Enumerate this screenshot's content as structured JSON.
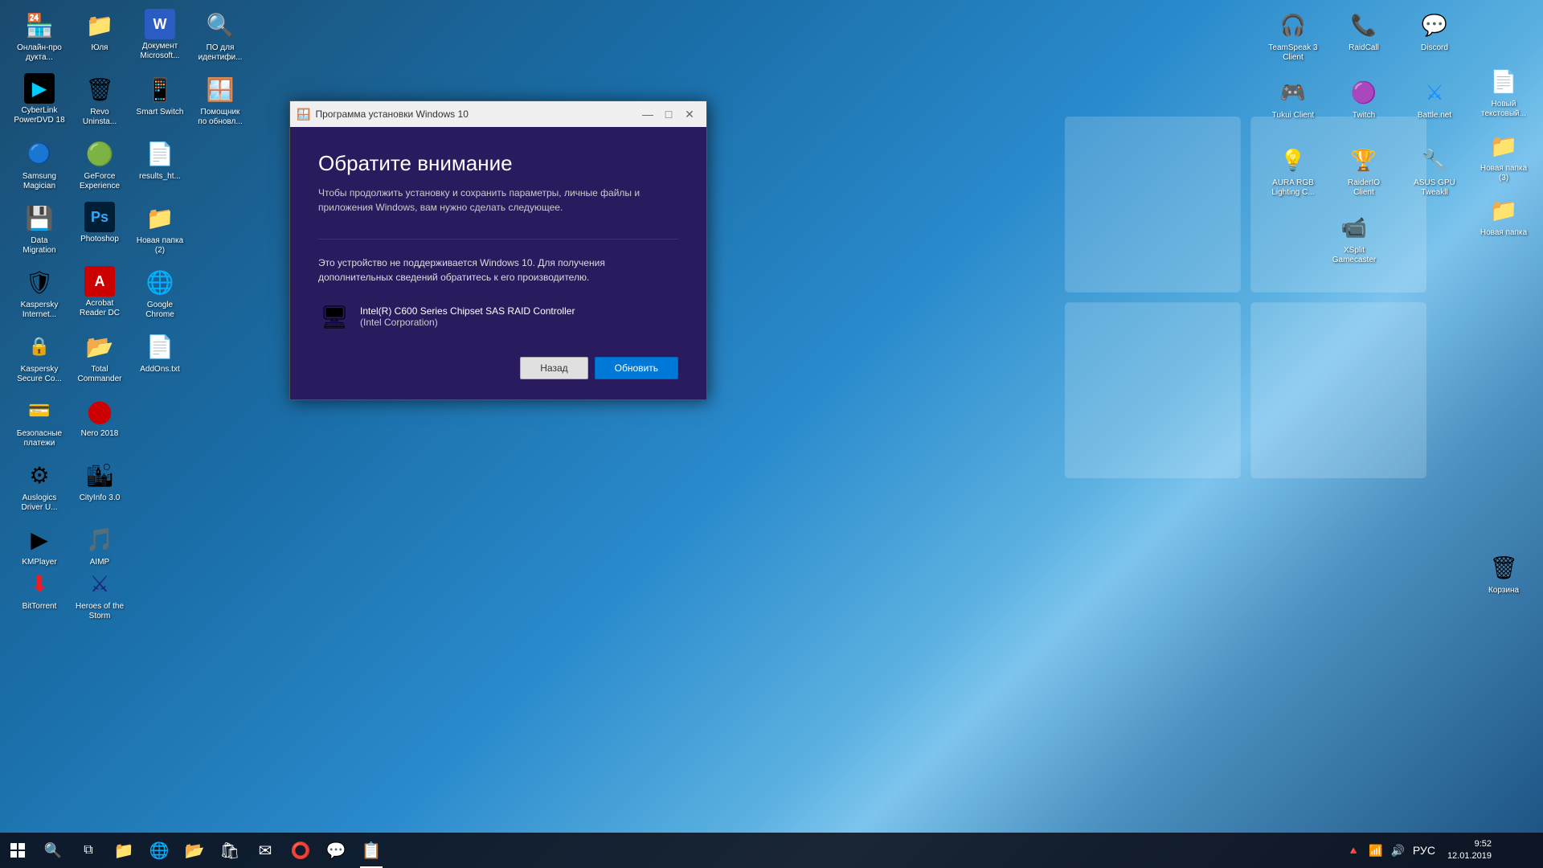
{
  "desktop": {
    "background": "Windows 10 blue gradient desktop"
  },
  "icons_left": [
    {
      "id": "online-product",
      "label": "Онлайн-про\nдукта...",
      "emoji": "🏪",
      "color": "#00aaff"
    },
    {
      "id": "yulia",
      "label": "Юля",
      "emoji": "📁",
      "color": "#ffcc00"
    },
    {
      "id": "word-doc",
      "label": "Документ Microsoft...",
      "emoji": "📄",
      "color": "#2b5cc4"
    },
    {
      "id": "po-dlia-ident",
      "label": "ПО для идентифи...",
      "emoji": "🔍",
      "color": "#aaaaaa"
    },
    {
      "id": "pomoshnik",
      "label": "Помощник по обновл...",
      "emoji": "🪟",
      "color": "#0078d7"
    },
    {
      "id": "cyberlink",
      "label": "CyberLink PowerDVD 18",
      "emoji": "▶",
      "color": "#1a3a6e"
    },
    {
      "id": "revo",
      "label": "Revo Uninsta...",
      "emoji": "🗑",
      "color": "#ff4400"
    },
    {
      "id": "smart-switch",
      "label": "Smart Switch",
      "emoji": "📱",
      "color": "#1565c0"
    },
    {
      "id": "samsung-magician",
      "label": "Samsung Magician",
      "emoji": "💿",
      "color": "#1e88e5"
    },
    {
      "id": "geforce",
      "label": "GeForce Experience",
      "emoji": "🟢",
      "color": "#76b900"
    },
    {
      "id": "results",
      "label": "results_ht...",
      "emoji": "📄",
      "color": "#cc0000"
    },
    {
      "id": "data-migration",
      "label": "Data Migration",
      "emoji": "💾",
      "color": "#1565c0"
    },
    {
      "id": "photoshop",
      "label": "Photoshop",
      "emoji": "🅿",
      "color": "#001e36"
    },
    {
      "id": "new-folder-2",
      "label": "Новая папка (2)",
      "emoji": "📁",
      "color": "#ffcc00"
    },
    {
      "id": "kaspersky-internet",
      "label": "Kaspersky Internet...",
      "emoji": "🛡",
      "color": "#009900"
    },
    {
      "id": "acrobat",
      "label": "Acrobat Reader DC",
      "emoji": "📕",
      "color": "#cc0000"
    },
    {
      "id": "google-chrome",
      "label": "Google Chrome",
      "emoji": "🌐",
      "color": "#4285f4"
    },
    {
      "id": "kaspersky-secure",
      "label": "Kaspersky Secure Co...",
      "emoji": "🔒",
      "color": "#009900"
    },
    {
      "id": "total-commander",
      "label": "Total Commander",
      "emoji": "📂",
      "color": "#ffcc00"
    },
    {
      "id": "addons",
      "label": "AddOns.txt",
      "emoji": "📄",
      "color": "#cccccc"
    },
    {
      "id": "bezopasnye",
      "label": "Безопасные платежи",
      "emoji": "💳",
      "color": "#009900"
    },
    {
      "id": "nero",
      "label": "Nero 2018",
      "emoji": "🔴",
      "color": "#cc0000"
    },
    {
      "id": "auslogics",
      "label": "Auslogics Driver U...",
      "emoji": "⚙",
      "color": "#0066cc"
    },
    {
      "id": "cityinfo",
      "label": "CityInfo 3.0",
      "emoji": "🏙",
      "color": "#0066ff"
    },
    {
      "id": "kmplayer",
      "label": "KMPlayer",
      "emoji": "▶",
      "color": "#ffcc00"
    },
    {
      "id": "aimp",
      "label": "AIMP",
      "emoji": "🎵",
      "color": "#ff6600"
    },
    {
      "id": "bittorrent",
      "label": "BitTorrent",
      "emoji": "⬇",
      "color": "#ee1c24"
    },
    {
      "id": "heroes-storm",
      "label": "Heroes of the Storm",
      "emoji": "⚔",
      "color": "#1a237e"
    }
  ],
  "icons_right": [
    {
      "id": "teamspeak",
      "label": "TeamSpeak 3 Client",
      "emoji": "🎧",
      "color": "#1a6ea8"
    },
    {
      "id": "raidcall",
      "label": "RaidCall",
      "emoji": "📞",
      "color": "#336699"
    },
    {
      "id": "discord",
      "label": "Discord",
      "emoji": "💬",
      "color": "#7289da"
    },
    {
      "id": "tukui",
      "label": "Tukui Client",
      "emoji": "🎮",
      "color": "#cc6600"
    },
    {
      "id": "twitch",
      "label": "Twitch",
      "emoji": "🟣",
      "color": "#6441a5"
    },
    {
      "id": "battlenet",
      "label": "Battle.net",
      "emoji": "⚔",
      "color": "#148eff"
    },
    {
      "id": "aura-rgb",
      "label": "AURA RGB Lighting C...",
      "emoji": "💡",
      "color": "#333"
    },
    {
      "id": "raiderio",
      "label": "RaiderIO Client",
      "emoji": "🏆",
      "color": "#cc3300"
    },
    {
      "id": "asus-gpu",
      "label": "ASUS GPU Tweakll",
      "emoji": "🔧",
      "color": "#0066cc"
    },
    {
      "id": "xsplit",
      "label": "XSplit Gamecaster",
      "emoji": "📹",
      "color": "#1565c0"
    },
    {
      "id": "new-folder-3",
      "label": "Новая папка (3)",
      "emoji": "📁",
      "color": "#ffcc00"
    },
    {
      "id": "new-folder",
      "label": "Новая папка",
      "emoji": "📁",
      "color": "#ffcc00"
    },
    {
      "id": "recycle",
      "label": "Корзина",
      "emoji": "🗑",
      "color": "#aaaaaa"
    },
    {
      "id": "new-txt",
      "label": "Новый текстовый...",
      "emoji": "📄",
      "color": "#cccccc"
    }
  ],
  "taskbar": {
    "start_icon": "⊞",
    "search_icon": "🔍",
    "task_view_icon": "⧉",
    "apps": [
      {
        "id": "explorer-icon",
        "emoji": "📁",
        "active": false
      },
      {
        "id": "edge-icon",
        "emoji": "🌐",
        "active": false
      },
      {
        "id": "files-icon",
        "emoji": "📂",
        "active": false
      },
      {
        "id": "store-icon",
        "emoji": "🛍",
        "active": false
      },
      {
        "id": "mail-icon",
        "emoji": "✉",
        "active": false
      },
      {
        "id": "opera-icon",
        "emoji": "⭕",
        "active": false
      },
      {
        "id": "discord-task",
        "emoji": "💬",
        "active": false
      },
      {
        "id": "active-app",
        "emoji": "📋",
        "active": true
      }
    ],
    "sys_icons": [
      "🔺",
      "🔊",
      "📶",
      "RU"
    ],
    "time": "9:52",
    "date": "12.01.2019",
    "lang": "РУС"
  },
  "dialog": {
    "title": "Программа установки Windows 10",
    "title_icon": "🪟",
    "heading": "Обратите внимание",
    "subtitle": "Чтобы продолжить установку и сохранить параметры, личные файлы и приложения Windows, вам нужно сделать следующее.",
    "warning": "Это устройство не поддерживается Windows 10. Для получения дополнительных сведений обратитесь к его производителю.",
    "device_name": "Intel(R) C600 Series Chipset SAS RAID Controller",
    "device_vendor": "(Intel Corporation)",
    "btn_back": "Назад",
    "btn_update": "Обновить",
    "controls": {
      "minimize": "—",
      "maximize": "□",
      "close": "✕"
    }
  }
}
